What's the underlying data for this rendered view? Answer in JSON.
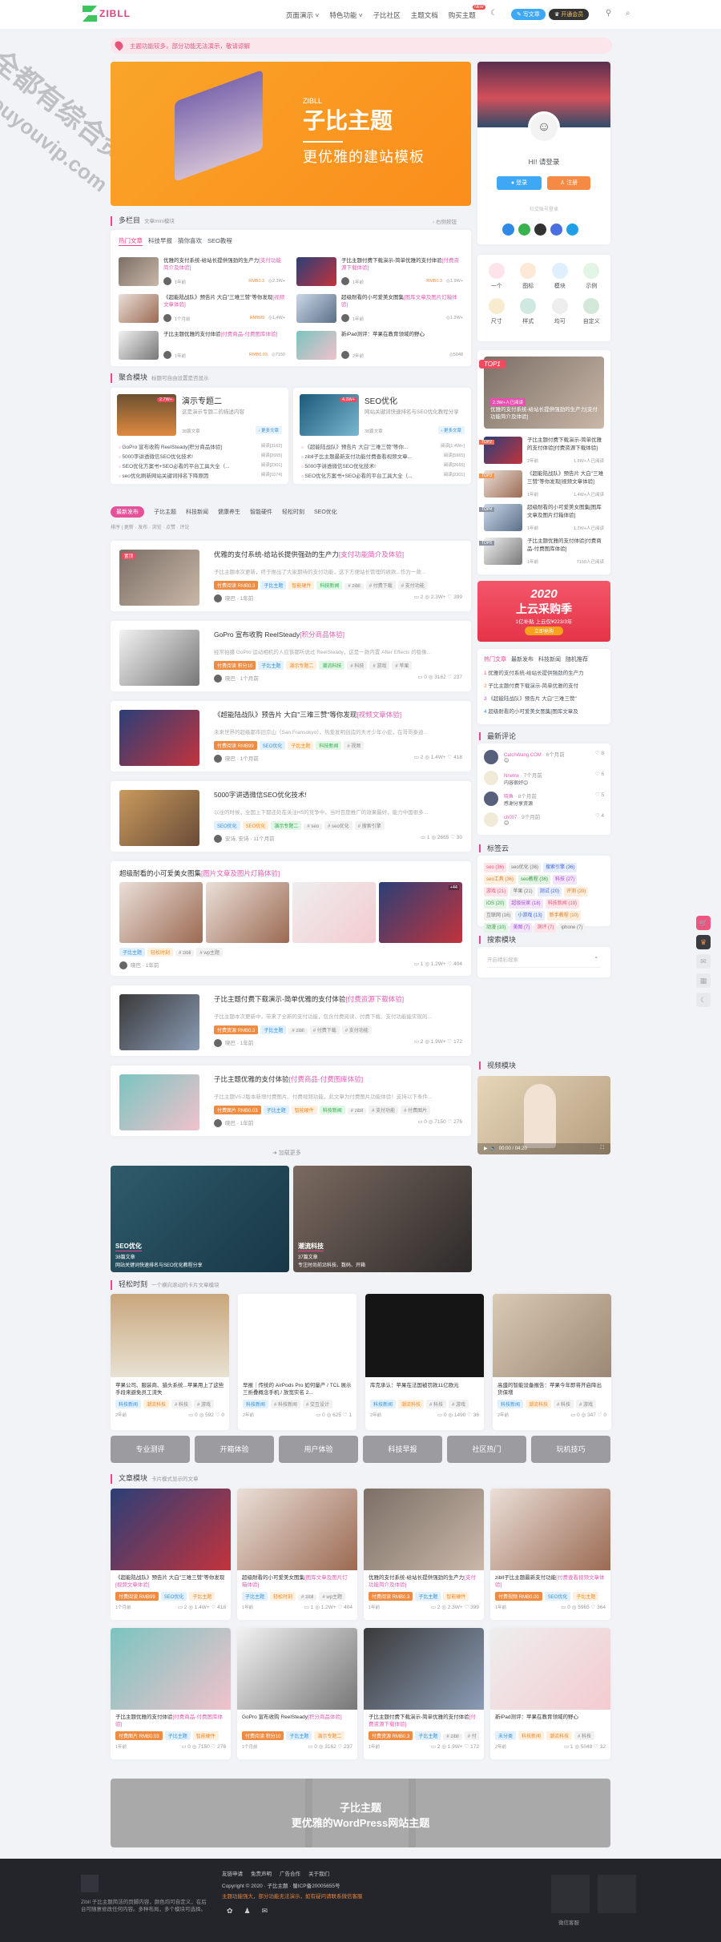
{
  "watermark": {
    "line1": "全都有综合资源网",
    "line2": "douyouvip.com"
  },
  "header": {
    "logo": "ZIBLL",
    "nav": [
      "页面演示",
      "特色功能",
      "子比社区",
      "主题文档",
      "购买主题"
    ],
    "nav_badge": "NEW",
    "write_button": "写文章",
    "vip_button": "开通会员"
  },
  "notice": "主题功能较多，部分功能无法演示，敬请谅解",
  "banner": {
    "logo": "ZIBLL",
    "title": "子比主题",
    "subtitle": "更优雅的建站模板"
  },
  "user_card": {
    "greeting": "HI! 请登录",
    "login": "登录",
    "register": "注册",
    "social_label": "社交账号登录"
  },
  "icon_grid": [
    "一个",
    "图标",
    "模块",
    "示例",
    "尺寸",
    "样式",
    "均可",
    "自定义"
  ],
  "top_list": {
    "items": [
      {
        "rank": "TOP1",
        "title": "优雅的支付系统-给站长提供强劲的生产力[支付功能简介及体验]",
        "views": "2.3W+人已阅读"
      },
      {
        "rank": "TOP2",
        "title": "子比主题付费下载演示-简单优雅的支付体验[付费资源下载体验]",
        "time": "2年前",
        "views": "1.9W+人已阅读"
      },
      {
        "rank": "TOP3",
        "title": "《超能陆战队》预告片 大白\"三难三赞\"等你发现[视频文章体验]",
        "time": "1年前",
        "views": "1.4W+人已阅读"
      },
      {
        "rank": "TOP4",
        "title": "超级耐看的小可爱美女图集[图库文章及图片灯箱体验]",
        "time": "1年前",
        "views": "1.2W+人已阅读"
      },
      {
        "rank": "TOP5",
        "title": "子比主题优雅的支付体验[付费商品-付费图库体验]",
        "time": "1年前",
        "views": "7150人已阅读"
      }
    ]
  },
  "ad": {
    "year": "2020",
    "title": "上云采购季",
    "sub": "1亿补贴 上云仅¥223/3年",
    "button": "立即抢购"
  },
  "hot_tabs": {
    "tabs": [
      "热门文章",
      "最新发布",
      "科技新闻",
      "随机推荐"
    ],
    "items": [
      "优雅的支付系统-给站长提供强劲的生产力",
      "子比主题付费下载演示-简单优雅的支付",
      "《超能陆战队》预告片 大白\"三难三赞\"",
      "超级耐看的小可爱美女图集[图库文章及"
    ]
  },
  "comments": {
    "title": "最新评论",
    "items": [
      {
        "user": "CatchWang.COM",
        "time": "6个月前",
        "likes": "8",
        "text": "😊"
      },
      {
        "user": "Nnetnx",
        "time": "7个月前",
        "likes": "6",
        "text": "内容很好😊"
      },
      {
        "user": "晓鱼",
        "time": "8个月前",
        "likes": "5",
        "text": "感谢分享资源"
      },
      {
        "user": "ch007",
        "time": "9个月前",
        "likes": "4",
        "text": "😊"
      }
    ]
  },
  "tags": {
    "title": "标签云",
    "items": [
      "seo (36)",
      "seo优化 (36)",
      "搜索引擎 (36)",
      "seo工具 (36)",
      "seo教程 (36)",
      "科技 (27)",
      "游戏 (21)",
      "苹果 (21)",
      "测试 (20)",
      "评测 (20)",
      "iOS (20)",
      "超级玩家 (18)",
      "科技新闻 (18)",
      "互联网 (16)",
      "小游戏 (13)",
      "新手教程 (10)",
      "动漫 (10)",
      "美图 (7)",
      "测评 (7)",
      "iphone (7)"
    ]
  },
  "search": {
    "title": "搜索模块",
    "placeholder": "开启精彩搜索"
  },
  "video": {
    "title": "视频模块",
    "time": "00:00 / 04:20"
  },
  "multi": {
    "title": "多栏目",
    "sub": "文章mini模块",
    "right": "右侧按钮",
    "tabs": [
      "热门文章",
      "科技早报",
      "猜你喜欢",
      "SEO教程"
    ],
    "items": [
      {
        "title": "优雅的支付系统-给站长提供强劲的生产力",
        "hl": "[支付功能简介及体验]",
        "time": "1年前",
        "price": "RMB0.3",
        "views": "2.3W+"
      },
      {
        "title": "子比主题付费下载演示-简单优雅的支付体验",
        "hl": "[付费资源下载体验]",
        "time": "1年前",
        "price": "RMB0.3",
        "views": "1.9W+"
      },
      {
        "title": "《超能陆战队》预告片 大白\"三难三赞\"等你发现",
        "hl": "[视频文章体验]",
        "time": "1个月前",
        "price": "RMB99",
        "views": "1.4W+"
      },
      {
        "title": "超级耐看的小可爱美女图集",
        "hl": "[图库文章及图片灯箱体验]",
        "time": "1年前",
        "price": "",
        "views": "1.2W+"
      },
      {
        "title": "子比主题优雅的支付体验",
        "hl": "[付费商品-付费图库体验]",
        "time": "1年前",
        "price": "RMB0.03",
        "views": "7150"
      },
      {
        "title": "新iPad测评：苹果在教育领域的野心",
        "hl": "",
        "time": "2年前",
        "price": "",
        "views": "5048"
      }
    ]
  },
  "aggregate": {
    "title": "聚合模块",
    "sub": "标题可自由设置是否显示",
    "cards": [
      {
        "name": "演示专题二",
        "desc": "这是演示专题二的描述内容",
        "badge": "2.7W+",
        "count": "38篇文章",
        "more": "更多文章",
        "list": [
          [
            "GoPro 宣布收购 ReelSteady[积分商品体验]",
            "阅读[3162]"
          ],
          [
            "5000字讲透微信SEO优化技术!",
            "阅读[2665]"
          ],
          [
            "SEO优化方案书+SEO必看的平台工具大全（...",
            "阅读[2301]"
          ],
          [
            "seo优化刷新网站关键词排名下降原因",
            "阅读[1074]"
          ]
        ]
      },
      {
        "name": "SEO优化",
        "desc": "网站关键词快速排名与SEO优化教程分享",
        "badge": "4.3W+",
        "count": "38篇文章",
        "more": "更多文章",
        "list": [
          [
            "《超能陆战队》预告片 大白\"三难三赞\"等你...",
            "阅读[1.4W+]"
          ],
          [
            "zibll子比主题最新支付功能付费查看视频文章...",
            "阅读[5965]"
          ],
          [
            "5000字讲透微信SEO优化技术!",
            "阅读[2665]"
          ],
          [
            "SEO优化方案书+SEO必看的平台工具大全（...",
            "阅读[2301]"
          ]
        ]
      }
    ]
  },
  "filter": {
    "tabs": [
      "最新发布",
      "子比主题",
      "科技新闻",
      "健康养生",
      "智能硬件",
      "轻松时刻",
      "SEO优化"
    ],
    "sort_label": "排序",
    "sorts": [
      "更新",
      "发布",
      "浏览",
      "点赞",
      "评论"
    ]
  },
  "posts": [
    {
      "title": "优雅的支付系统-给站长提供强劲的生产力",
      "hl": "[支付功能简介及体验]",
      "badge": "置顶",
      "desc": "子比主题本次更新，终于推出了大家期待的支付功能，这下方便站长管理的收款...作为一款...",
      "tags": [
        [
          "付费阅读 RMB0.3",
          "o"
        ],
        [
          "子比主题",
          "b"
        ],
        [
          "智能硬件",
          "y"
        ],
        [
          "科技新闻",
          "g"
        ],
        [
          "# zibll",
          ""
        ],
        [
          "# 付费下载",
          ""
        ],
        [
          "# 支付功能",
          ""
        ]
      ],
      "author": "晓巴",
      "time": "1年前",
      "stats": [
        "2",
        "2.3W+",
        "399"
      ]
    },
    {
      "title": "GoPro 宣布收购 ReelSteady",
      "hl": "[积分商品体验]",
      "desc": "经常拍摄 GoPro 运动相机的人应该都听说过 ReelSteady，这是一款内置 After Effects 的稳像...",
      "tags": [
        [
          "付费阅读 积分10",
          "o"
        ],
        [
          "子比主题",
          "b"
        ],
        [
          "演示专题二",
          "y"
        ],
        [
          "潮流科技",
          "g"
        ],
        [
          "# 科技",
          ""
        ],
        [
          "# 游戏",
          ""
        ],
        [
          "# 苹果",
          ""
        ]
      ],
      "author": "晓巴",
      "time": "1个月前",
      "stats": [
        "0",
        "3162",
        "237"
      ]
    },
    {
      "title": "《超能陆战队》预告片 大白\"三难三赞\"等你发现",
      "hl": "[视频文章体验]",
      "desc": "未来世界的超级都市旧京山（San Fransokyo），热爱发明创造的天才少年小宏，在哥哥泰迪...",
      "tags": [
        [
          "付费阅读 RMB99",
          "o"
        ],
        [
          "SEO优化",
          "b"
        ],
        [
          "子比主题",
          "y"
        ],
        [
          "科技新闻",
          "g"
        ],
        [
          "# 视频",
          ""
        ]
      ],
      "author": "晓巴",
      "time": "1个月前",
      "stats": [
        "2",
        "1.4W+",
        "418"
      ]
    },
    {
      "title": "5000字讲透微信SEO优化技术!",
      "hl": "",
      "desc": "以往的时候，全国上下都还处在关注H5的竞争中，当时百度推广的效果最好，能力中国很多...",
      "tags": [
        [
          "SEO优化",
          "b"
        ],
        [
          "SEO优化",
          "y"
        ],
        [
          "演示专题二",
          "g"
        ],
        [
          "# seo",
          ""
        ],
        [
          "# seo优化",
          ""
        ],
        [
          "# 搜索引擎",
          ""
        ]
      ],
      "author": "安诗, 安诗",
      "time": "11个月前",
      "stats": [
        "1",
        "2665",
        "30"
      ]
    },
    {
      "title": "子比主题付费下载演示-简单优雅的支付体验",
      "hl": "[付费资源下载体验]",
      "desc": "子比主题本次更新中，带来了全新的支付功能，包含付费阅读、付费下载、支付功能能实现的...",
      "tags": [
        [
          "付费资源 RMB0.3",
          "o"
        ],
        [
          "子比主题",
          "b"
        ],
        [
          "# zibll",
          ""
        ],
        [
          "# 付费下载",
          ""
        ],
        [
          "# 支付功能",
          ""
        ]
      ],
      "author": "晓巴",
      "time": "1年前",
      "stats": [
        "2",
        "1.9W+",
        "172"
      ]
    },
    {
      "title": "子比主题优雅的支付体验",
      "hl": "[付费商品-付费图库体验]",
      "desc": "子比主题V5.2版本新增付费图片、付费视频功能，此文章为付费图片功能体验！支持以下条件...",
      "tags": [
        [
          "付费图片 RMB0.03",
          "o"
        ],
        [
          "子比主题",
          "b"
        ],
        [
          "智能硬件",
          "y"
        ],
        [
          "科技新闻",
          "g"
        ],
        [
          "# zibll",
          ""
        ],
        [
          "# 支付功能",
          ""
        ],
        [
          "# 付费图片",
          ""
        ]
      ],
      "author": "晓巴",
      "time": "1年前",
      "stats": [
        "0",
        "7150",
        "276"
      ]
    }
  ],
  "gallery_post": {
    "title": "超级耐看的小可爱美女图集",
    "hl": "[图片文章及图片灯箱体验]",
    "count": "+44",
    "tags": [
      [
        "子比主题",
        "b"
      ],
      [
        "轻松时刻",
        "y"
      ],
      [
        "# zibll",
        ""
      ],
      [
        "# wp主题",
        ""
      ]
    ],
    "author": "晓巴",
    "time": "1年前",
    "stats": [
      "1",
      "1.2W+",
      "404"
    ]
  },
  "load_more": "加载更多",
  "categories": [
    {
      "name": "SEO优化",
      "count": "38篇文章",
      "desc": "网站关键词快速排名与SEO优化教程分享"
    },
    {
      "name": "潮流科技",
      "count": "37篇文章",
      "desc": "专注时尚前沿科技、数码、开箱"
    }
  ],
  "relax": {
    "title": "轻松时刻",
    "sub": "一个横向滚动的卡片文章模块",
    "cards": [
      {
        "title": "苹果公司、服装商、猎头系统...苹果用上了这些手段来避免员工流失",
        "tags": [
          [
            "科技新闻",
            "b"
          ],
          [
            "潮流科技",
            "y"
          ],
          [
            "# 科技",
            ""
          ],
          [
            "# 游戏",
            ""
          ]
        ],
        "time": "2年前",
        "stats": [
          "0",
          "592",
          "0"
        ]
      },
      {
        "title": "早报｜传统的 AirPods Pro 如何量产 / TCL 展示三折叠概念手机 / 放宽实名 2...",
        "tags": [
          [
            "科技新闻",
            "b"
          ],
          [
            "# 科技新闻",
            ""
          ],
          [
            "# 交互设计",
            ""
          ]
        ],
        "time": "2年前",
        "stats": [
          "0",
          "625",
          "1"
        ]
      },
      {
        "title": "库克承认：苹果在法国被罚款11亿欧元",
        "tags": [
          [
            "科技新闻",
            "b"
          ],
          [
            "潮流科技",
            "y"
          ],
          [
            "# 科技",
            ""
          ],
          [
            "# 游戏",
            ""
          ]
        ],
        "time": "2年前",
        "stats": [
          "0",
          "1490",
          "36"
        ]
      },
      {
        "title": "高盛的智能设备报告：苹果今年即将开启降出货保增",
        "tags": [
          [
            "科技新闻",
            "b"
          ],
          [
            "潮流科技",
            "y"
          ],
          [
            "# 科技",
            ""
          ],
          [
            "# 游戏",
            ""
          ]
        ],
        "time": "2年前",
        "stats": [
          "0",
          "347",
          "0"
        ]
      }
    ]
  },
  "buttons": [
    "专业测评",
    "开箱体验",
    "用户体验",
    "科技早报",
    "社区热门",
    "玩机技巧"
  ],
  "article_block": {
    "title": "文章模块",
    "sub": "卡片模式显示的文章",
    "cards": [
      {
        "title": "《超能陆战队》预告片 大白\"三难三赞\"等你发现",
        "hl": "[视频文章体验]",
        "tags": [
          [
            "付费阅读 RMB99",
            "o"
          ],
          [
            "SEO优化",
            "b"
          ],
          [
            "子比主题",
            "y"
          ]
        ],
        "time": "1个月前",
        "stats": [
          "2",
          "1.4W+",
          "418"
        ]
      },
      {
        "title": "超级耐看的小可爱美女图集",
        "hl": "[图库文章及图片灯箱体验]",
        "tags": [
          [
            "子比主题",
            "b"
          ],
          [
            "轻松时刻",
            "y"
          ],
          [
            "# zibll",
            ""
          ],
          [
            "# wp主题",
            ""
          ]
        ],
        "time": "1年前",
        "stats": [
          "1",
          "1.2W+",
          "404"
        ]
      },
      {
        "title": "优雅的支付系统-给站长提供强劲的生产力",
        "hl": "[支付功能简介及体验]",
        "tags": [
          [
            "付费阅读 RMB0.3",
            "o"
          ],
          [
            "子比主题",
            "b"
          ],
          [
            "智能硬件",
            "y"
          ]
        ],
        "time": "1年前",
        "stats": [
          "2",
          "2.3W+",
          "399"
        ]
      },
      {
        "title": "zibll子比主题最新支付功能",
        "hl": "[付费查看视频文章体验]",
        "tags": [
          [
            "付费视频 RMB0.00",
            "o"
          ],
          [
            "SEO优化",
            "b"
          ],
          [
            "子比主题",
            "y"
          ]
        ],
        "time": "1年前",
        "stats": [
          "0",
          "5965",
          "364"
        ]
      },
      {
        "title": "子比主题优雅的支付体验",
        "hl": "[付费商品-付费图库体验]",
        "tags": [
          [
            "付费图片 RMB0.03",
            "o"
          ],
          [
            "子比主题",
            "b"
          ],
          [
            "智能硬件",
            "y"
          ]
        ],
        "time": "1年前",
        "stats": [
          "0",
          "7150",
          "276"
        ]
      },
      {
        "title": "GoPro 宣布收购 ReelSteady",
        "hl": "[积分商品体验]",
        "tags": [
          [
            "付费阅读 积分10",
            "o"
          ],
          [
            "子比主题",
            "b"
          ],
          [
            "演示专题二",
            "y"
          ]
        ],
        "time": "1个月前",
        "stats": [
          "0",
          "3162",
          "237"
        ]
      },
      {
        "title": "子比主题付费下载演示-简单优雅的支付体验",
        "hl": "[付费资源下载体验]",
        "tags": [
          [
            "付费资源 RMB0.3",
            "o"
          ],
          [
            "子比主题",
            "b"
          ],
          [
            "# zibll",
            ""
          ],
          [
            "# 付",
            ""
          ]
        ],
        "time": "1年前",
        "stats": [
          "2",
          "1.9W+",
          "172"
        ]
      },
      {
        "title": "新iPad测评：苹果在教育领域的野心",
        "hl": "",
        "tags": [
          [
            "未分类",
            "b"
          ],
          [
            "科技新闻",
            "y"
          ],
          [
            "潮流科技",
            "y"
          ],
          [
            "# 科技",
            ""
          ]
        ],
        "time": "2年前",
        "stats": [
          "1",
          "5048",
          "32"
        ]
      }
    ]
  },
  "bottom_banner": {
    "title": "子比主题",
    "sub": "更优雅的WordPress网站主题"
  },
  "footer": {
    "desc": "Zibll 子比主题简洁的页脚内容，颜色均可自定义，在后台可随意修改任何内容。多种布局，多个模块可选择。",
    "links": [
      "友链申请",
      "免责声明",
      "广告合作",
      "关于我们"
    ],
    "copyright": "Copyright © 2020 · 子比主题 · 蜀ICP备20005655号",
    "notice": "主题功能强大，部分功能无法演示，如有疑问请联系微信客服",
    "qr_label": "微信客服"
  },
  "colors": {
    "accent": "#f04494",
    "orange": "#f08c42",
    "footer_bg": "#23252b"
  }
}
